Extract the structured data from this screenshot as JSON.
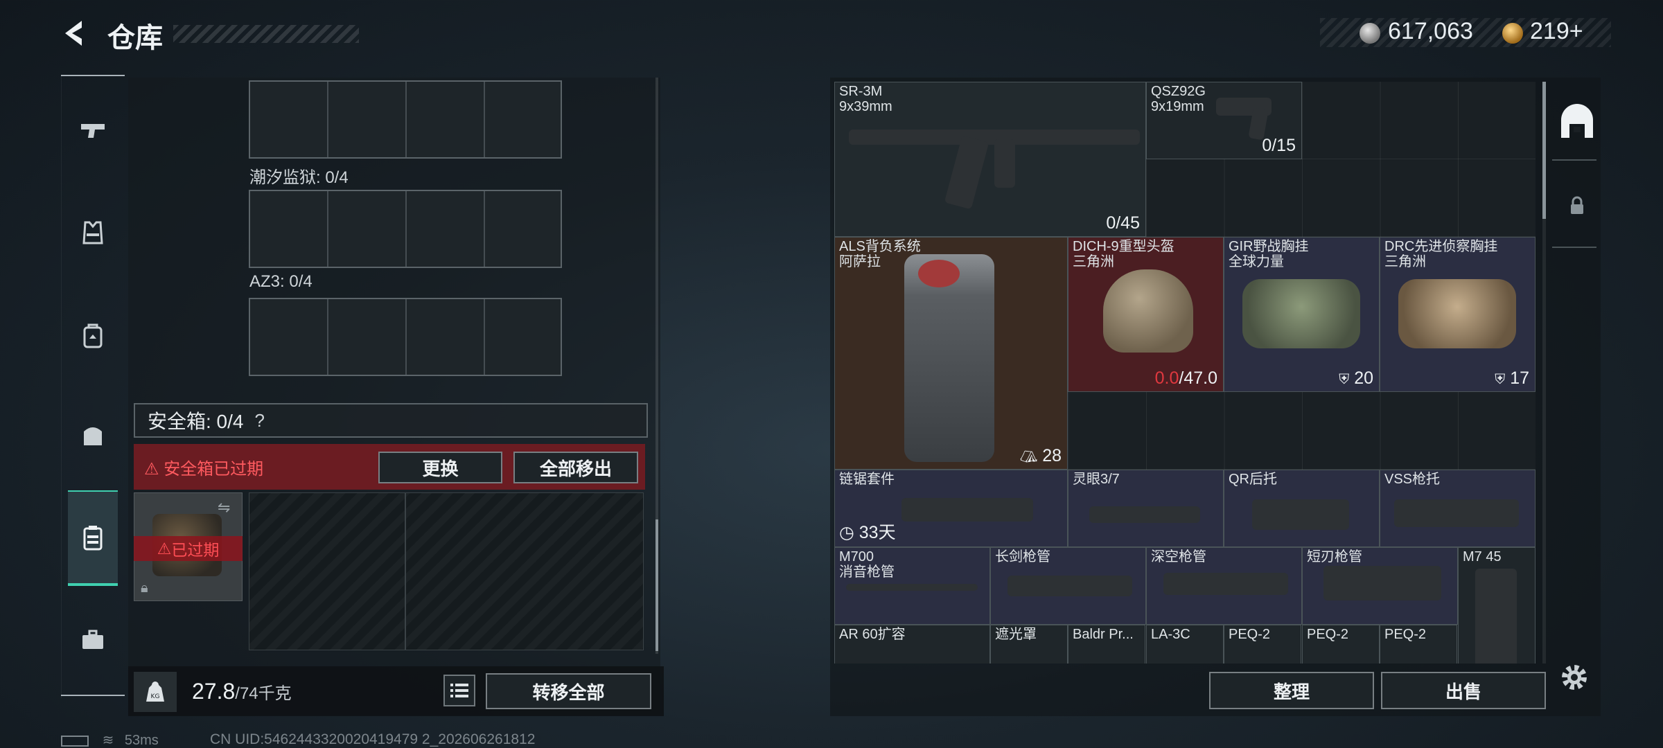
{
  "header": {
    "title": "仓库",
    "currency_primary": "617,063",
    "currency_secondary": "219+",
    "primary_color": "#d8d8d8",
    "secondary_color": "#e0a13a"
  },
  "nav": {
    "items": [
      "pistol-icon",
      "vest-icon",
      "backpack-icon",
      "bag-icon",
      "safe-case-icon",
      "briefcase-icon"
    ],
    "active_index": 4,
    "accent": "#3fd0b0"
  },
  "left": {
    "slot_labels": [
      "潮汐监狱: 0/4",
      "AZ3: 0/4"
    ],
    "safe_box_label": "安全箱: 0/4",
    "help": "?",
    "expired_banner": "安全箱已过期",
    "replace_btn": "更换",
    "move_all_btn": "全部移出",
    "case_expired": "已过期",
    "weight": "27.8",
    "weight_max": "/74千克",
    "weight_icon_text": "KG",
    "transfer_all_btn": "转移全部"
  },
  "status": {
    "ping": "53ms",
    "uid": "CN UID:5462443320020419479 2_202606261812"
  },
  "items": [
    {
      "name": "SR-3M",
      "sub": "9x39mm",
      "count": "0/45"
    },
    {
      "name": "QSZ92G",
      "sub": "9x19mm",
      "count": "0/15"
    },
    {
      "name": "ALS背负系统",
      "sub": "阿萨拉",
      "count": "28"
    },
    {
      "name": "DICH-9重型头盔",
      "sub": "三角洲",
      "count_red": "0.0",
      "count": "/47.0"
    },
    {
      "name": "GIR野战胸挂",
      "sub": "全球力量",
      "count": "20"
    },
    {
      "name": "DRC先进侦察胸挂",
      "sub": "三角洲",
      "count": "17"
    },
    {
      "name": "链锯套件",
      "sub": "",
      "count": "33天"
    },
    {
      "name": "灵眼3/7",
      "sub": "",
      "count": ""
    },
    {
      "name": "QR后托",
      "sub": "",
      "count": ""
    },
    {
      "name": "VSS枪托",
      "sub": "",
      "count": ""
    },
    {
      "name": "M700",
      "sub": "消音枪管",
      "count": ""
    },
    {
      "name": "长剑枪管",
      "sub": "",
      "count": ""
    },
    {
      "name": "深空枪管",
      "sub": "",
      "count": ""
    },
    {
      "name": "短刃枪管",
      "sub": "",
      "count": ""
    },
    {
      "name": "M7 45",
      "sub": "",
      "count": ""
    },
    {
      "name": "AR 60扩容",
      "sub": "",
      "count": ""
    },
    {
      "name": "遮光罩",
      "sub": "",
      "count": ""
    },
    {
      "name": "Baldr Pr...",
      "sub": "",
      "count": ""
    },
    {
      "name": "LA-3C",
      "sub": "",
      "count": ""
    },
    {
      "name": "PEQ-2",
      "sub": "",
      "count": ""
    },
    {
      "name": "PEQ-2",
      "sub": "",
      "count": ""
    },
    {
      "name": "PEQ-2",
      "sub": "",
      "count": ""
    }
  ],
  "right": {
    "organize_btn": "整理",
    "sell_btn": "出售"
  }
}
